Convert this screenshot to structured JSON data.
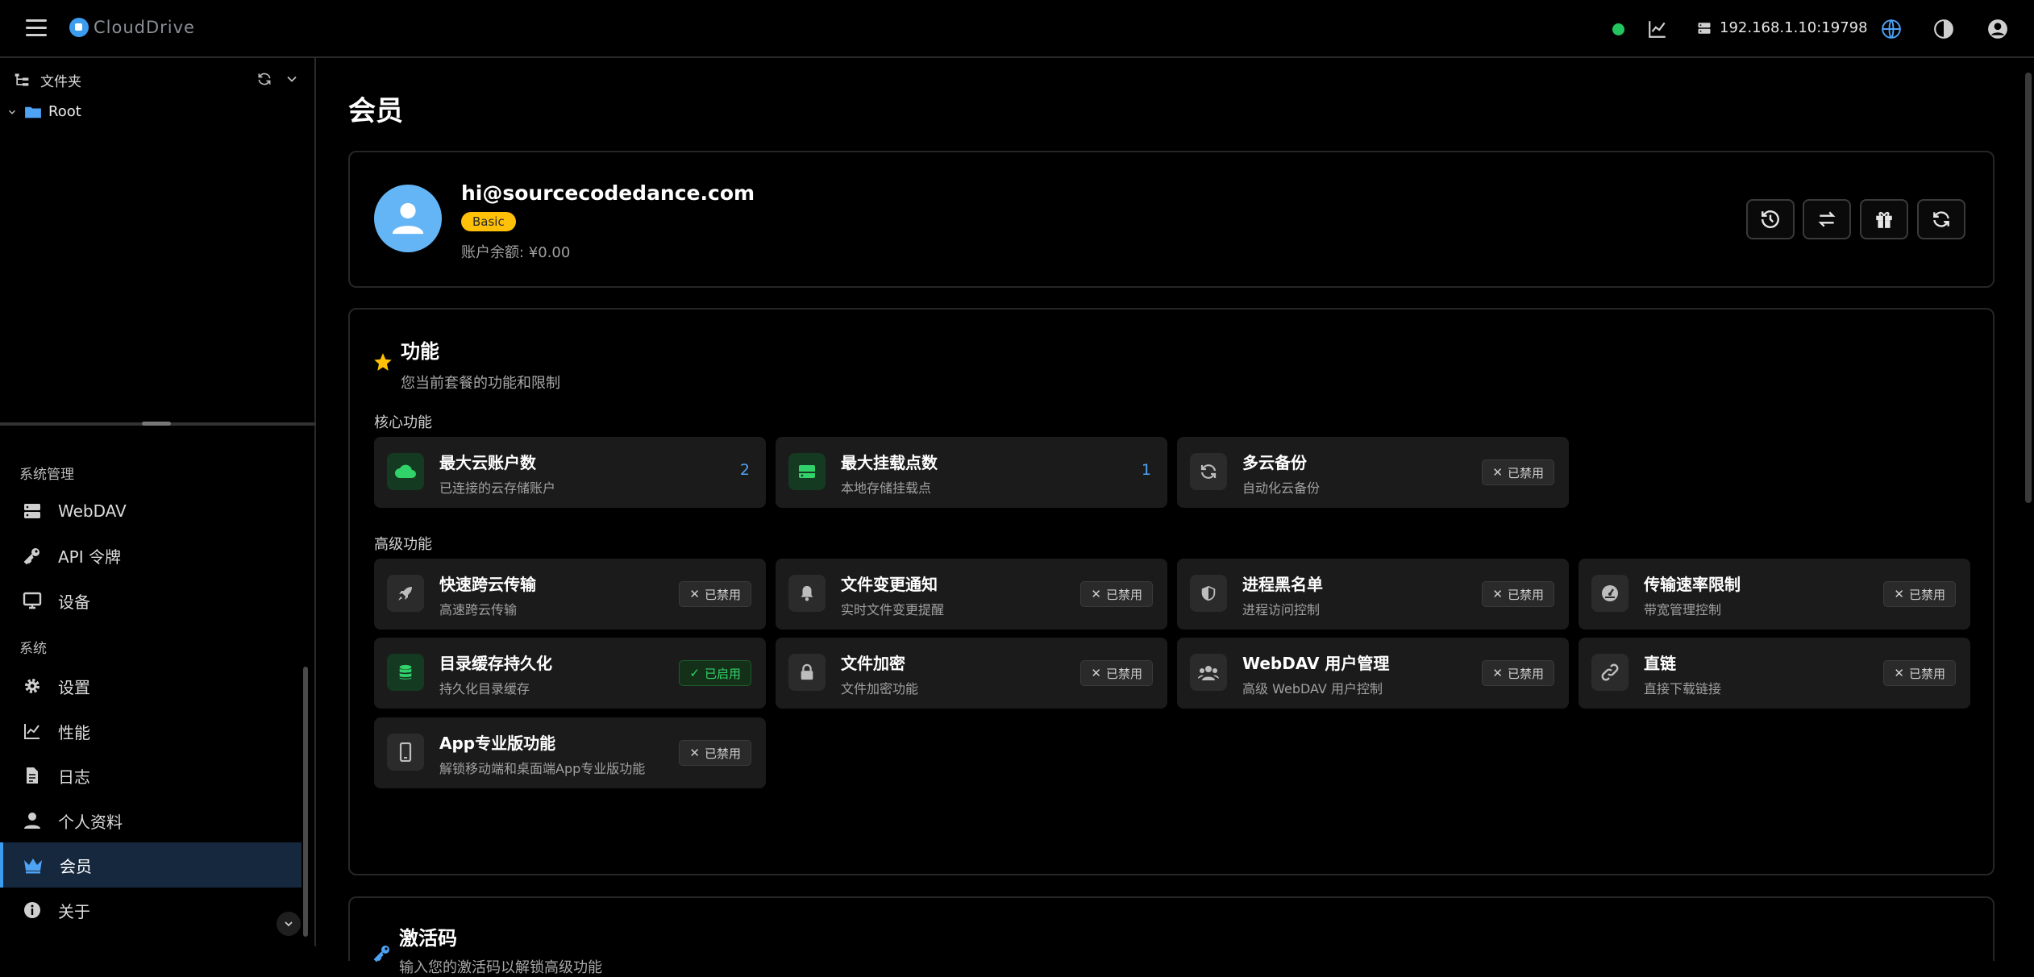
{
  "app": {
    "brand": "CloudDrive"
  },
  "topbar": {
    "server_address": "192.168.1.10:19798"
  },
  "folder_panel": {
    "title": "文件夹",
    "root_label": "Root"
  },
  "nav": {
    "section_admin": "系统管理",
    "section_system": "系统",
    "items": [
      {
        "label": "WebDAV",
        "icon": "server-icon"
      },
      {
        "label": "API 令牌",
        "icon": "key-icon"
      },
      {
        "label": "设备",
        "icon": "monitor-icon"
      },
      {
        "label": "设置",
        "icon": "gear-icon"
      },
      {
        "label": "性能",
        "icon": "chart-icon"
      },
      {
        "label": "日志",
        "icon": "document-icon"
      },
      {
        "label": "个人资料",
        "icon": "user-icon"
      },
      {
        "label": "会员",
        "icon": "crown-icon",
        "active": true
      },
      {
        "label": "关于",
        "icon": "info-icon"
      }
    ]
  },
  "page": {
    "title": "会员"
  },
  "account": {
    "email": "hi@sourcecodedance.com",
    "plan": "Basic",
    "balance": "账户余额: ¥0.00"
  },
  "features": {
    "title": "功能",
    "subtitle": "您当前套餐的功能和限制",
    "core_label": "核心功能",
    "advanced_label": "高级功能",
    "status_disabled": "已禁用",
    "status_enabled": "已启用",
    "core": [
      {
        "name": "最大云账户数",
        "desc": "已连接的云存储账户",
        "value": "2",
        "icon": "cloud-icon"
      },
      {
        "name": "最大挂载点数",
        "desc": "本地存储挂载点",
        "value": "1",
        "icon": "drive-icon"
      },
      {
        "name": "多云备份",
        "desc": "自动化云备份",
        "icon": "sync-icon"
      }
    ],
    "advanced": [
      {
        "name": "快速跨云传输",
        "desc": "高速跨云传输",
        "icon": "rocket-icon"
      },
      {
        "name": "文件变更通知",
        "desc": "实时文件变更提醒",
        "icon": "bell-icon"
      },
      {
        "name": "进程黑名单",
        "desc": "进程访问控制",
        "icon": "shield-icon"
      },
      {
        "name": "传输速率限制",
        "desc": "带宽管理控制",
        "icon": "gauge-icon"
      },
      {
        "name": "目录缓存持久化",
        "desc": "持久化目录缓存",
        "icon": "database-icon"
      },
      {
        "name": "文件加密",
        "desc": "文件加密功能",
        "icon": "lock-icon"
      },
      {
        "name": "WebDAV 用户管理",
        "desc": "高级 WebDAV 用户控制",
        "icon": "users-icon"
      },
      {
        "name": "直链",
        "desc": "直接下载链接",
        "icon": "link-icon"
      },
      {
        "name": "App专业版功能",
        "desc": "解锁移动端和桌面端App专业版功能",
        "icon": "phone-icon"
      }
    ]
  },
  "activation": {
    "title": "激活码",
    "subtitle": "输入您的激活码以解锁高级功能"
  },
  "colors": {
    "accent": "#3b9cf0",
    "badge": "#ffc107",
    "online": "#23c55e",
    "enabled": "#32d26a"
  }
}
